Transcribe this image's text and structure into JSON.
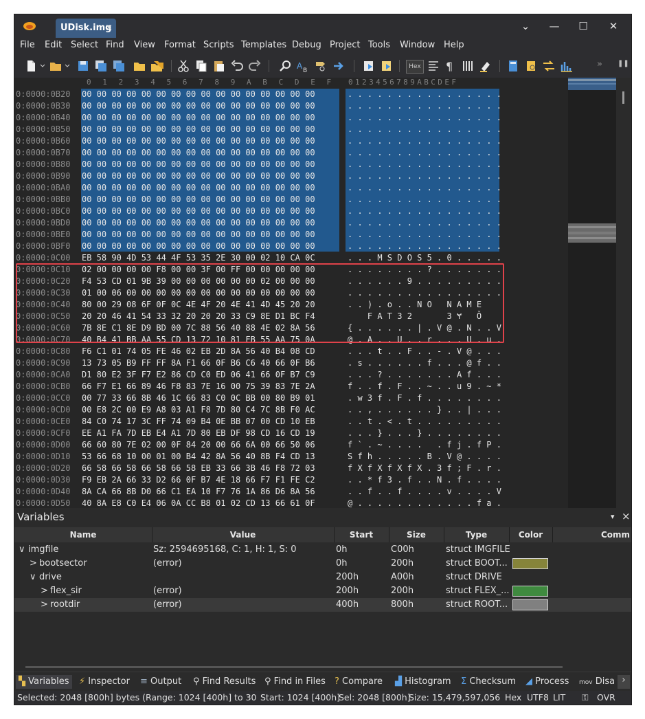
{
  "window": {
    "tab_title": "UDisk.img",
    "tab_close": "×",
    "dropdown": "⌄",
    "minimize": "—",
    "maximize": "☐",
    "close": "✕"
  },
  "menu": [
    "File",
    "Edit",
    "Select",
    "Find",
    "View",
    "Format",
    "Scripts",
    "Templates",
    "Debug",
    "Project",
    "Tools",
    "Window",
    "Help"
  ],
  "toolbar": {
    "hex_mode": "Hex",
    "overflow": "»",
    "pause": "❚❚"
  },
  "hex_columns": [
    "0",
    "1",
    "2",
    "3",
    "4",
    "5",
    "6",
    "7",
    "8",
    "9",
    "A",
    "B",
    "C",
    "D",
    "E",
    "F"
  ],
  "ascii_columns": "0123456789ABCDEF",
  "rows": [
    {
      "addr": "0:0000:0B20",
      "bytes": "00 00 00 00 00 00 00 00 00 00 00 00 00 00 00 00",
      "ascii": ". . . . . . . . . . . . . . . ."
    },
    {
      "addr": "0:0000:0B30",
      "bytes": "00 00 00 00 00 00 00 00 00 00 00 00 00 00 00 00",
      "ascii": ". . . . . . . . . . . . . . . ."
    },
    {
      "addr": "0:0000:0B40",
      "bytes": "00 00 00 00 00 00 00 00 00 00 00 00 00 00 00 00",
      "ascii": ". . . . . . . . . . . . . . . ."
    },
    {
      "addr": "0:0000:0B50",
      "bytes": "00 00 00 00 00 00 00 00 00 00 00 00 00 00 00 00",
      "ascii": ". . . . . . . . . . . . . . . ."
    },
    {
      "addr": "0:0000:0B60",
      "bytes": "00 00 00 00 00 00 00 00 00 00 00 00 00 00 00 00",
      "ascii": ". . . . . . . . . . . . . . . ."
    },
    {
      "addr": "0:0000:0B70",
      "bytes": "00 00 00 00 00 00 00 00 00 00 00 00 00 00 00 00",
      "ascii": ". . . . . . . . . . . . . . . ."
    },
    {
      "addr": "0:0000:0B80",
      "bytes": "00 00 00 00 00 00 00 00 00 00 00 00 00 00 00 00",
      "ascii": ". . . . . . . . . . . . . . . ."
    },
    {
      "addr": "0:0000:0B90",
      "bytes": "00 00 00 00 00 00 00 00 00 00 00 00 00 00 00 00",
      "ascii": ". . . . . . . . . . . . . . . ."
    },
    {
      "addr": "0:0000:0BA0",
      "bytes": "00 00 00 00 00 00 00 00 00 00 00 00 00 00 00 00",
      "ascii": ". . . . . . . . . . . . . . . ."
    },
    {
      "addr": "0:0000:0BB0",
      "bytes": "00 00 00 00 00 00 00 00 00 00 00 00 00 00 00 00",
      "ascii": ". . . . . . . . . . . . . . . ."
    },
    {
      "addr": "0:0000:0BC0",
      "bytes": "00 00 00 00 00 00 00 00 00 00 00 00 00 00 00 00",
      "ascii": ". . . . . . . . . . . . . . . ."
    },
    {
      "addr": "0:0000:0BD0",
      "bytes": "00 00 00 00 00 00 00 00 00 00 00 00 00 00 00 00",
      "ascii": ". . . . . . . . . . . . . . . ."
    },
    {
      "addr": "0:0000:0BE0",
      "bytes": "00 00 00 00 00 00 00 00 00 00 00 00 00 00 00 00",
      "ascii": ". . . . . . . . . . . . . . . ."
    },
    {
      "addr": "0:0000:0BF0",
      "bytes": "00 00 00 00 00 00 00 00 00 00 00 00 00 00 00 00",
      "ascii": ". . . . . . . . . . . . . . . ."
    },
    {
      "addr": "0:0000:0C00",
      "bytes": "EB 58 90 4D 53 44 4F 53 35 2E 30 00 02 10 CA 0C",
      "ascii": ". . . M S D O S 5 . 0 . . . . ."
    },
    {
      "addr": "0:0000:0C10",
      "bytes": "02 00 00 00 00 F8 00 00 3F 00 FF 00 00 00 00 00",
      "ascii": ". . . . . . . . ? . . . . . . ."
    },
    {
      "addr": "0:0000:0C20",
      "bytes": "F4 53 CD 01 9B 39 00 00 00 00 00 00 02 00 00 00",
      "ascii": ". . . . . . 9 . . . . . . . . ."
    },
    {
      "addr": "0:0000:0C30",
      "bytes": "01 00 06 00 00 00 00 00 00 00 00 00 00 00 00 00",
      "ascii": ". . . . . . . . . . . . . . . ."
    },
    {
      "addr": "0:0000:0C40",
      "bytes": "80 00 29 08 6F 0F 0C 4E 4F 20 4E 41 4D 45 20 20",
      "ascii": ". . ) . o . . N O   N A M E    "
    },
    {
      "addr": "0:0000:0C50",
      "bytes": "20 20 46 41 54 33 32 20 20 20 33 C9 8E D1 BC F4",
      "ascii": "    F A T 3 2       3 Ɏ   Ǒ    "
    },
    {
      "addr": "0:0000:0C60",
      "bytes": "7B 8E C1 8E D9 BD 00 7C 88 56 40 88 4E 02 8A 56",
      "ascii": "{ . . . . . . | . V @ . N . . V"
    },
    {
      "addr": "0:0000:0C70",
      "bytes": "40 B4 41 BB AA 55 CD 13 72 10 81 FB 55 AA 75 0A",
      "ascii": "@ . A . . U . . r . . . U . u ."
    },
    {
      "addr": "0:0000:0C80",
      "bytes": "F6 C1 01 74 05 FE 46 02 EB 2D 8A 56 40 B4 08 CD",
      "ascii": ". . . t . . F . . - . V @ . . ."
    },
    {
      "addr": "0:0000:0C90",
      "bytes": "13 73 05 B9 FF FF 8A F1 66 0F B6 C6 40 66 0F B6",
      "ascii": ". s . . . . . . f . . . @ f . ."
    },
    {
      "addr": "0:0000:0CA0",
      "bytes": "D1 80 E2 3F F7 E2 86 CD C0 ED 06 41 66 0F B7 C9",
      "ascii": ". . . ? . . . . . . . A f . . ."
    },
    {
      "addr": "0:0000:0CB0",
      "bytes": "66 F7 E1 66 89 46 F8 83 7E 16 00 75 39 83 7E 2A",
      "ascii": "f . . f . F . . ~ . . u 9 . ~ *"
    },
    {
      "addr": "0:0000:0CC0",
      "bytes": "00 77 33 66 8B 46 1C 66 83 C0 0C BB 00 80 B9 01",
      "ascii": ". w 3 f . F . f . . . . . . . ."
    },
    {
      "addr": "0:0000:0CD0",
      "bytes": "00 E8 2C 00 E9 A8 03 A1 F8 7D 80 C4 7C 8B F0 AC",
      "ascii": ". . , . . . . . . } . . | . . ."
    },
    {
      "addr": "0:0000:0CE0",
      "bytes": "84 C0 74 17 3C FF 74 09 B4 0E BB 07 00 CD 10 EB",
      "ascii": ". . t . < . t . . . . . . . . ."
    },
    {
      "addr": "0:0000:0CF0",
      "bytes": "EE A1 FA 7D EB E4 A1 7D 80 EB DF 98 CD 16 CD 19",
      "ascii": ". . . } . . . } . . . . . . . ."
    },
    {
      "addr": "0:0000:0D00",
      "bytes": "66 60 80 7E 02 00 0F 84 20 00 66 6A 00 66 50 06",
      "ascii": "f ` . ~ . . . .   . f j . f P ."
    },
    {
      "addr": "0:0000:0D10",
      "bytes": "53 66 68 10 00 01 00 B4 42 8A 56 40 8B F4 CD 13",
      "ascii": "S f h . . . . . B . V @ . . . ."
    },
    {
      "addr": "0:0000:0D20",
      "bytes": "66 58 66 58 66 58 66 58 EB 33 66 3B 46 F8 72 03",
      "ascii": "f X f X f X f X . 3 f ; F . r ."
    },
    {
      "addr": "0:0000:0D30",
      "bytes": "F9 EB 2A 66 33 D2 66 0F B7 4E 18 66 F7 F1 FE C2",
      "ascii": ". . * f 3 . f . . N . f . . . ."
    },
    {
      "addr": "0:0000:0D40",
      "bytes": "8A CA 66 8B D0 66 C1 EA 10 F7 76 1A 86 D6 8A 56",
      "ascii": ". . f . . f . . . . v . . . . V"
    },
    {
      "addr": "0:0000:0D50",
      "bytes": "40 8A E8 C0 E4 06 0A CC B8 01 02 CD 13 66 61 0F",
      "ascii": "@ . . . . . . . . . . . . f a ."
    }
  ],
  "variables": {
    "title": "Variables",
    "pin": "▾",
    "close": "×",
    "headers": {
      "name": "Name",
      "value": "Value",
      "start": "Start",
      "size": "Size",
      "type": "Type",
      "color": "Color",
      "comment": "Comm"
    },
    "rows": [
      {
        "expander": "∨",
        "name": "imgfile",
        "value": "Sz: 2594695168, C: 1, H: 1, S: 0",
        "start": "0h",
        "size": "C00h",
        "type": "struct IMGFILE",
        "color": ""
      },
      {
        "expander": ">",
        "name": "bootsector",
        "value": "(error)",
        "start": "0h",
        "size": "200h",
        "type": "struct BOOT...",
        "color": "#86843a"
      },
      {
        "expander": "∨",
        "name": "drive",
        "value": "",
        "start": "200h",
        "size": "A00h",
        "type": "struct DRIVE",
        "color": ""
      },
      {
        "expander": ">",
        "name": "flex_sir",
        "value": "(error)",
        "start": "200h",
        "size": "200h",
        "type": "struct FLEX_...",
        "color": "#3f8a3f"
      },
      {
        "expander": ">",
        "name": "rootdir",
        "value": "(error)",
        "start": "400h",
        "size": "800h",
        "type": "struct ROOT...",
        "color": "#808080"
      }
    ]
  },
  "bottom_tabs": [
    "Variables",
    "Inspector",
    "Output",
    "Find Results",
    "Find in Files",
    "Compare",
    "Histogram",
    "Checksum",
    "Process",
    "Disa"
  ],
  "status": {
    "selected": "Selected: 2048 [800h] bytes (Range: 1024 [400h] to 3071 [BFF",
    "start": "Start: 1024 [400h]",
    "sel": "Sel: 2048 [800h]",
    "size": "Size: 15,479,597,056",
    "mode": "Hex",
    "encoding": "UTF8",
    "endian": "LIT",
    "ovr": "OVR"
  }
}
